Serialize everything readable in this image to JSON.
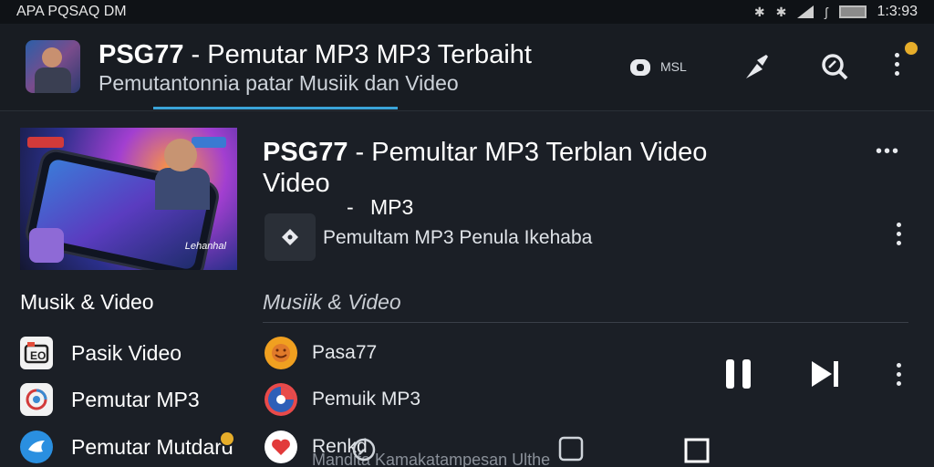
{
  "status_bar": {
    "left_text": "APA PQSAQ DM",
    "time": "1:3:93",
    "icons": [
      "bluetooth-icon",
      "bluetooth-icon",
      "signal-icon",
      "vibrate-icon",
      "battery-icon"
    ]
  },
  "app_bar": {
    "title_bold": "PSG77",
    "title_rest": " - Pemutar MP3 MP3 Terbaiht",
    "subtitle": "Pemutantonnia patar Musiik dan Video",
    "actions": [
      {
        "icon": "cast-icon",
        "label": "MSL"
      },
      {
        "icon": "pin-icon",
        "label": ""
      },
      {
        "icon": "search-icon",
        "label": ""
      },
      {
        "icon": "more-vert-icon",
        "label": ""
      }
    ]
  },
  "hero": {
    "title_bold": "PSG77",
    "title_rest": " - Pemultar MP3 Terblan Video Video",
    "subtitle_dash": "-",
    "subtitle": "MP3",
    "row_text": "Pemultam MP3 Penula Ikehaba",
    "thumb_brand": "Lehanhal"
  },
  "sections": {
    "left_header": "Musik & Video",
    "right_header": "Musiik & Video"
  },
  "left_items": [
    {
      "label": "Pasik Video",
      "icon": "video-player-icon"
    },
    {
      "label": "Pemutar MP3",
      "icon": "music-app-icon"
    },
    {
      "label": "Pemutar Mutdard",
      "icon": "bird-app-icon"
    }
  ],
  "right_items": [
    {
      "label": "Pasa77",
      "icon": "avatar-icon"
    },
    {
      "label": "Pemuik MP3",
      "icon": "music-disc-icon"
    },
    {
      "label": "Renkd",
      "icon": "heart-icon"
    }
  ],
  "bottom_ghost_text": "Mandita Kamakatampesan Ulthe",
  "colors": {
    "accent": "#3aa3d8",
    "badge": "#e6ad2a",
    "background": "#1b1f26",
    "app_bar": "#181c22"
  }
}
